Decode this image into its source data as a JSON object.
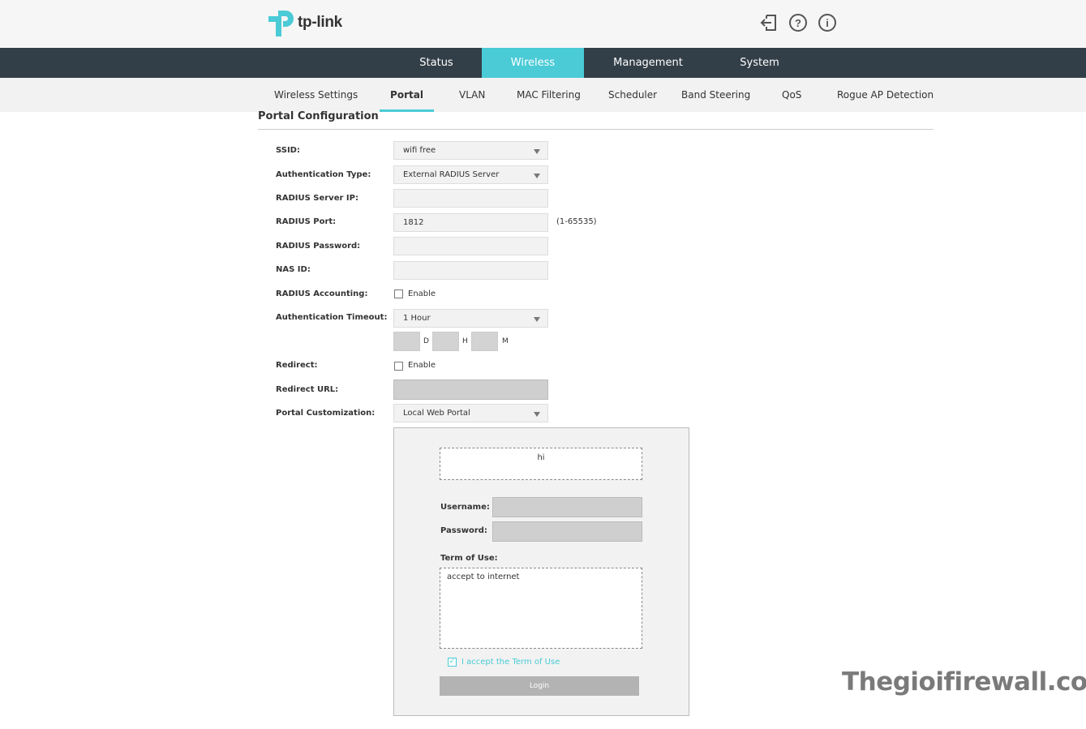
{
  "brand": {
    "logo_text": "tp-link",
    "accent_color": "#4acbd6",
    "nav_bg_color": "#333f48"
  },
  "header_icons": [
    {
      "name": "logout-icon"
    },
    {
      "name": "help-icon",
      "glyph": "?"
    },
    {
      "name": "info-icon",
      "glyph": "i"
    }
  ],
  "main_nav": {
    "items": [
      {
        "label": "Status"
      },
      {
        "label": "Wireless",
        "active": true
      },
      {
        "label": "Management"
      },
      {
        "label": "System"
      }
    ]
  },
  "sub_nav": {
    "items": [
      {
        "label": "Wireless Settings"
      },
      {
        "label": "Portal",
        "active": true
      },
      {
        "label": "VLAN"
      },
      {
        "label": "MAC Filtering"
      },
      {
        "label": "Scheduler"
      },
      {
        "label": "Band Steering"
      },
      {
        "label": "QoS"
      },
      {
        "label": "Rogue AP Detection"
      }
    ]
  },
  "form": {
    "title": "Portal Configuration",
    "ssid": {
      "label": "SSID:",
      "value": "wifi free"
    },
    "auth_type": {
      "label": "Authentication Type:",
      "value": "External RADIUS Server"
    },
    "radius_ip": {
      "label": "RADIUS Server IP:",
      "value": ""
    },
    "radius_port": {
      "label": "RADIUS Port:",
      "value": "1812",
      "hint": "(1-65535)"
    },
    "radius_password": {
      "label": "RADIUS Password:",
      "value": ""
    },
    "nas_id": {
      "label": "NAS ID:",
      "value": ""
    },
    "radius_accounting": {
      "label": "RADIUS Accounting:",
      "checkbox_label": "Enable",
      "checked": false
    },
    "auth_timeout": {
      "label": "Authentication Timeout:",
      "value": "1 Hour",
      "unit_d": "D",
      "unit_h": "H",
      "unit_m": "M"
    },
    "redirect": {
      "label": "Redirect:",
      "checkbox_label": "Enable",
      "checked": false
    },
    "redirect_url": {
      "label": "Redirect URL:",
      "value": ""
    },
    "portal_customization": {
      "label": "Portal Customization:",
      "value": "Local Web Portal"
    }
  },
  "portal_preview": {
    "welcome_text": "hi",
    "username_label": "Username:",
    "password_label": "Password:",
    "terms_label": "Term of Use:",
    "terms_text": "accept to internet",
    "accept_label": "I accept the Term of Use",
    "accept_checked": true,
    "login_label": "Login"
  },
  "watermark": "Thegioifirewall.com"
}
